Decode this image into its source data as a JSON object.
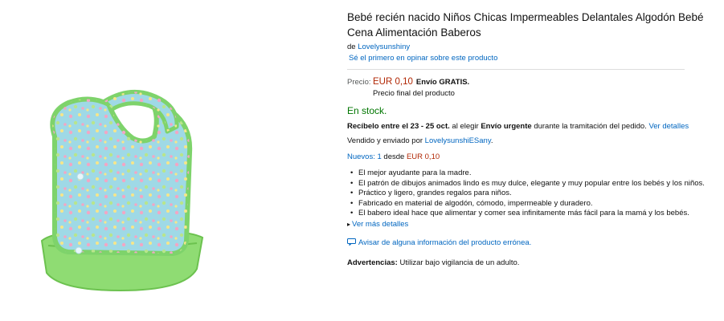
{
  "product": {
    "title": "Bebé recién nacido Niños Chicas Impermeables Delantales Algodón Bebé Cena Alimentación Baberos",
    "by_prefix": "de",
    "brand": "Lovelysunshiny",
    "review_link": "Sé el primero en opinar sobre este producto"
  },
  "price": {
    "label": "Precio:",
    "value": "EUR 0,10",
    "shipping": "Envío GRATIS.",
    "final_note": "Precio final del producto"
  },
  "availability": {
    "stock": "En stock.",
    "delivery_prefix": "Recíbelo entre el 23 - 25 oct.",
    "delivery_middle": "al elegir",
    "delivery_option": "Envío urgente",
    "delivery_suffix": "durante la tramitación del pedido.",
    "details_link": "Ver detalles",
    "seller_prefix": "Vendido y enviado por",
    "seller_name": "LovelysunshiESany",
    "seller_suffix": "."
  },
  "offers": {
    "new_label": "Nuevos: 1",
    "from_label": "desde",
    "from_price": "EUR 0,10"
  },
  "features": [
    "El mejor ayudante para la madre.",
    "El patrón de dibujos animados lindo es muy dulce, elegante y muy popular entre los bebés y los niños.",
    "Práctico y ligero, grandes regalos para niños.",
    "Fabricado en material de algodón, cómodo, impermeable y duradero.",
    "El babero ideal hace que alimentar y comer sea infinitamente más fácil para la mamá y los bebés."
  ],
  "see_more": "Ver más detalles",
  "report_link": "Avisar de alguna información del producto errónea.",
  "warnings": {
    "label": "Advertencias:",
    "text": "Utilizar bajo vigilancia de un adulto."
  },
  "icons": {
    "bullet": "bullet-dot",
    "caret": "caret-right-icon",
    "report": "speech-bubble-icon"
  },
  "colors": {
    "link": "#0066c0",
    "price": "#b12704",
    "stock": "#007600",
    "bib_fabric": "#9fd9e6",
    "bib_trim": "#7ed36b"
  }
}
